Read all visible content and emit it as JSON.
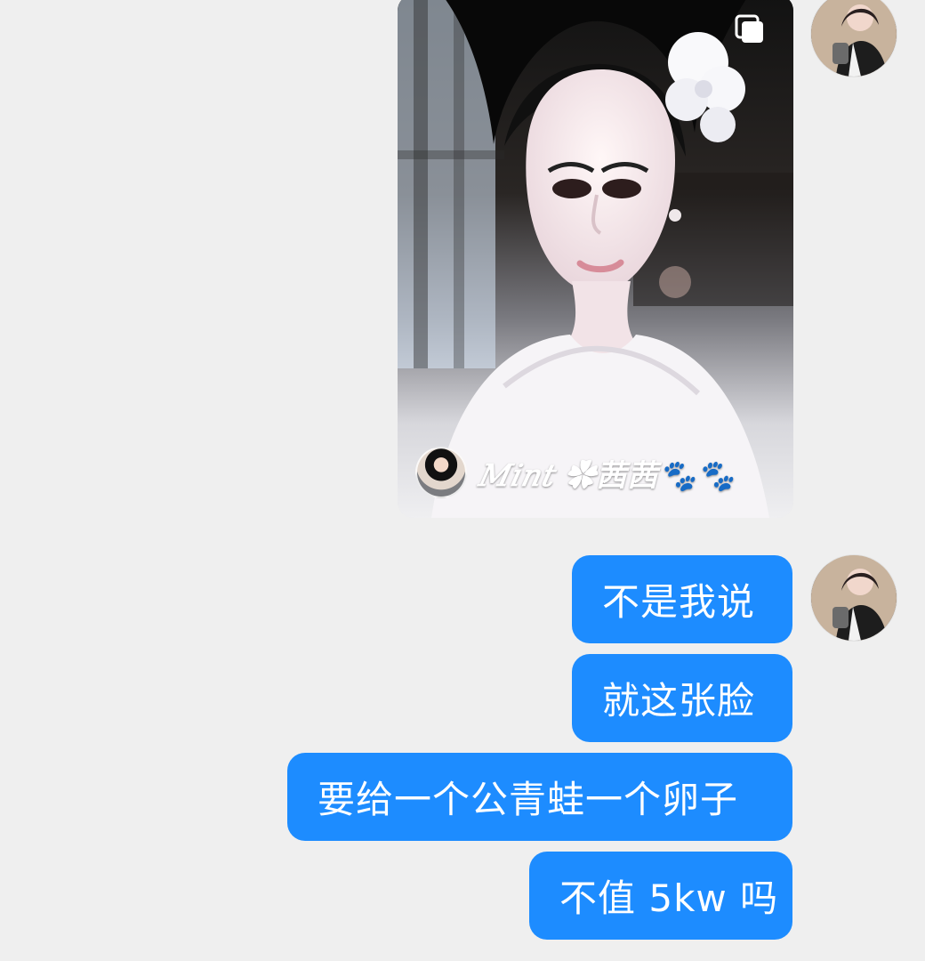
{
  "chat": {
    "shared_post": {
      "author_name": "𝑀𝑖𝑛𝑡 ✿茜茜🐾🐾",
      "multi_image_icon": "stack-icon",
      "photo_description": "portrait photo"
    },
    "messages": [
      {
        "text": "不是我说"
      },
      {
        "text": "就这张脸"
      },
      {
        "text": "要给一个公青蛙一个卵子"
      },
      {
        "text": "不值 5kw 吗"
      }
    ]
  },
  "colors": {
    "background": "#efefef",
    "bubble_blue": "#1d8cff",
    "bubble_text": "#ffffff"
  }
}
